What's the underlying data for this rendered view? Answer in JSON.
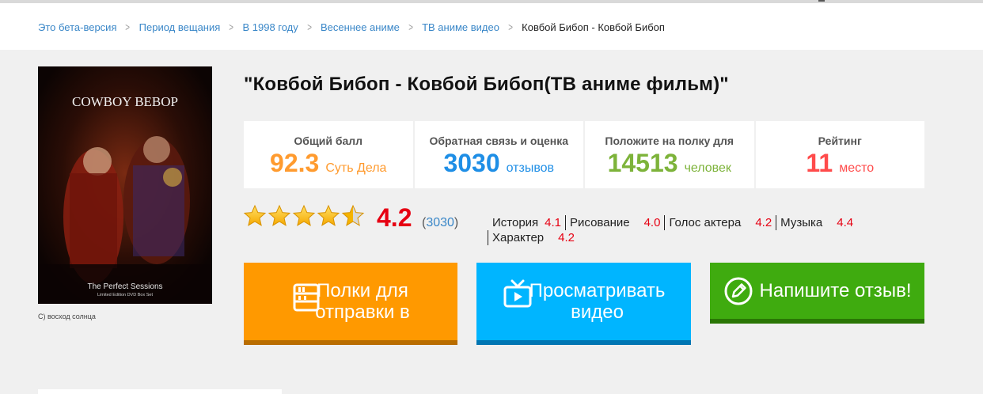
{
  "breadcrumb": {
    "items": [
      "Это бета-версия",
      "Период вещания",
      "В 1998 году",
      "Весеннее аниме",
      "ТВ аниме видео"
    ],
    "current": "Ковбой Бибоп - Ковбой Бибоп"
  },
  "poster": {
    "title": "COWBOY BEBOP",
    "subtitle": "The Perfect Sessions",
    "subtitle2": "Limited Edition DVD Box Set",
    "caption": "C) восход солнца"
  },
  "title": "\"Ковбой Бибоп - Ковбой Бибоп(ТВ аниме фильм)\"",
  "stats": [
    {
      "label": "Общий балл",
      "value": "92.3",
      "unit": "Суть Дела",
      "color": "#ff9b2f"
    },
    {
      "label": "Обратная связь и оценка",
      "value": "3030",
      "unit": "отзывов",
      "color": "#1e8ee6"
    },
    {
      "label": "Положите на полку для",
      "value": "14513",
      "unit": "человек",
      "color": "#7db33a"
    },
    {
      "label": "Рейтинг",
      "value": "11",
      "unit": "место",
      "color": "#ff4b4b"
    }
  ],
  "rating": {
    "stars": 4.5,
    "score": "4.2",
    "open": "(",
    "count": "3030",
    "close": ")"
  },
  "sub_ratings": [
    {
      "name": "История",
      "value": "4.1"
    },
    {
      "name": "Рисование",
      "value": "4.0"
    },
    {
      "name": "Голос актера",
      "value": "4.2"
    },
    {
      "name": "Музыка",
      "value": "4.4"
    },
    {
      "name": "Характер",
      "value": "4.2"
    }
  ],
  "buttons": {
    "shelf": {
      "line1": "Полки для",
      "line2": "отправки в",
      "icon": "bookshelf-icon"
    },
    "video": {
      "line1": "Просматривать",
      "line2": "видео",
      "icon": "tv-icon"
    },
    "review": {
      "label": "Напишите отзыв!",
      "icon": "pencil-icon"
    }
  },
  "colors": {
    "accent_link": "#3a87c8",
    "score_red": "#e60012",
    "shelf_orange": "#ff9900",
    "video_blue": "#00b5ff",
    "review_green": "#3fab0f"
  }
}
